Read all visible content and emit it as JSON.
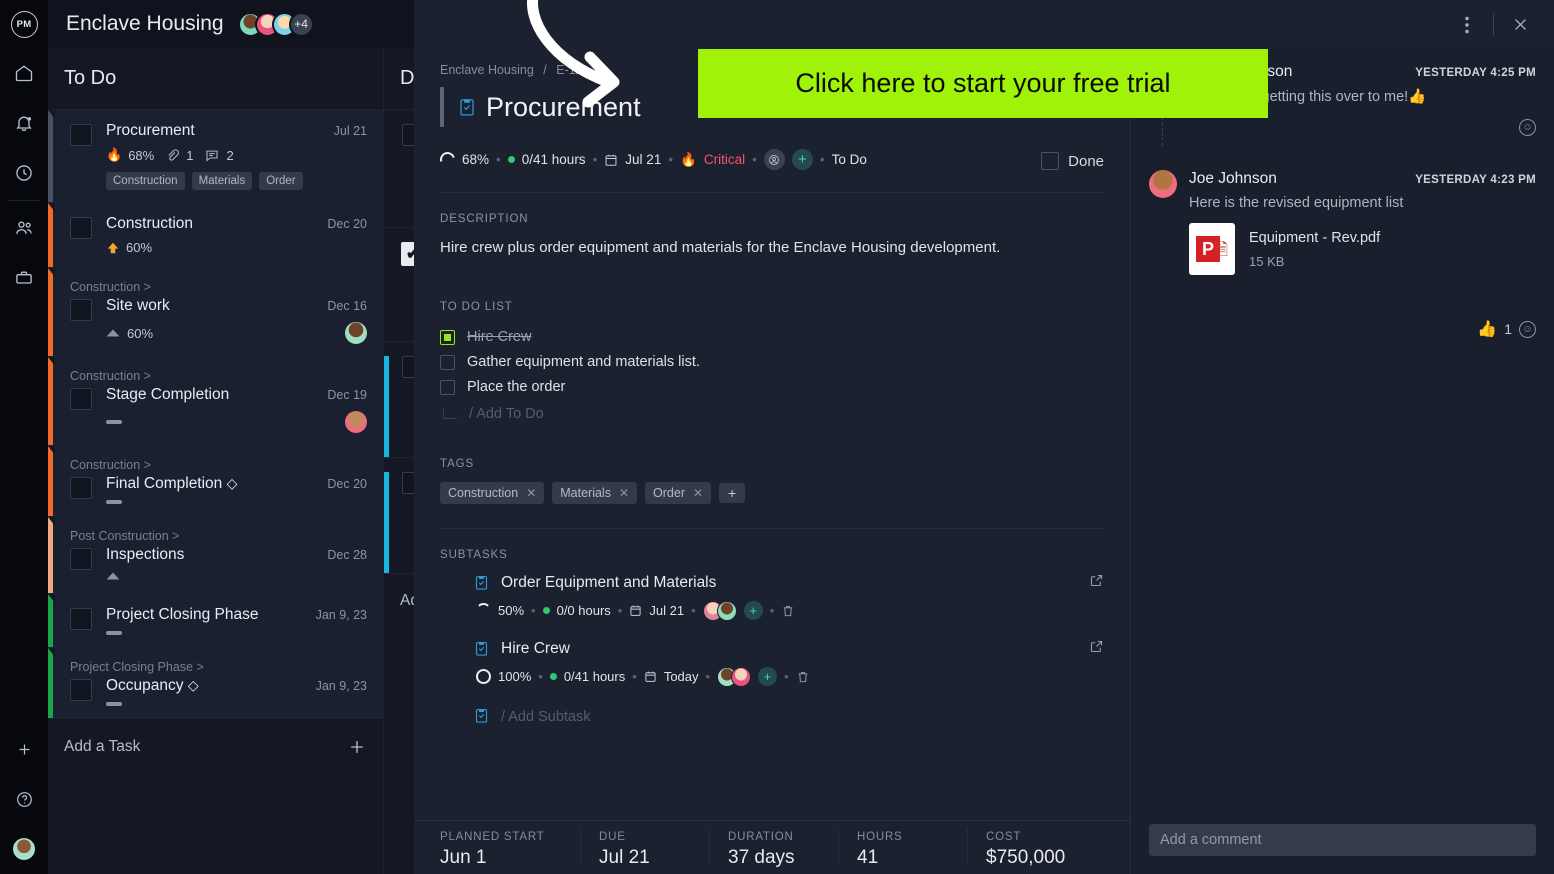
{
  "rail": {
    "logo": "PM",
    "items": [
      {
        "name": "home-icon",
        "label": "Home"
      },
      {
        "name": "notifications-icon",
        "label": "Notifications"
      },
      {
        "name": "time-icon",
        "label": "Time"
      },
      {
        "name": "people-icon",
        "label": "People"
      },
      {
        "name": "portfolio-icon",
        "label": "Portfolio"
      }
    ],
    "bottom": [
      {
        "name": "add-icon",
        "label": "+"
      },
      {
        "name": "help-icon",
        "label": "?"
      },
      {
        "name": "user-avatar",
        "label": ""
      }
    ]
  },
  "board": {
    "project_title": "Enclave Housing",
    "avatars_more": "+4",
    "columns": [
      {
        "title": "To Do",
        "add_label": "Add a Task",
        "add_icon": "plus-icon",
        "tasks": [
          {
            "name": "Procurement",
            "date": "Jul 21",
            "bar": "#4a5162",
            "priority_icon": "fire-icon",
            "progress": "68%",
            "attachments": "1",
            "comments": "2",
            "tags": [
              "Construction",
              "Materials",
              "Order"
            ]
          },
          {
            "name": "Construction",
            "date": "Dec 20",
            "bar": "#ef6b2b",
            "priority_icon": "up-arrow-icon",
            "progress": "60%",
            "tags": []
          },
          {
            "parent": "Construction >",
            "name": "Site work",
            "date": "Dec 16",
            "bar": "#ef6b2b",
            "priority_icon": "triangle-up-icon",
            "progress": "60%",
            "avatar": "green",
            "tags": []
          },
          {
            "parent": "Construction >",
            "name": "Stage Completion",
            "date": "Dec 19",
            "bar": "#ef6b2b",
            "priority_icon": "dash-icon",
            "progress": "",
            "avatar": "red",
            "tags": []
          },
          {
            "parent": "Construction >",
            "name": "Final Completion",
            "date": "Dec 20",
            "bar": "#ef6b2b",
            "milestone": "◇",
            "priority_icon": "dash-icon",
            "progress": "",
            "tags": []
          },
          {
            "parent": "Post Construction >",
            "name": "Inspections",
            "date": "Dec 28",
            "bar": "#f2a982",
            "priority_icon": "triangle-up-icon",
            "progress": "",
            "tags": []
          },
          {
            "name": "Project Closing Phase",
            "date": "Jan 9, 23",
            "bar": "#1aa44c",
            "priority_icon": "dash-icon",
            "progress": "",
            "tags": []
          },
          {
            "parent": "Project Closing Phase >",
            "name": "Occupancy",
            "date": "Jan 9, 23",
            "bar": "#1aa44c",
            "milestone": "◇",
            "priority_icon": "dash-icon",
            "progress": "",
            "tags": []
          }
        ]
      },
      {
        "title": "D",
        "add_label": "Ad"
      }
    ]
  },
  "modal": {
    "menu_icon": "kebab-menu-icon",
    "close_icon": "close-icon",
    "breadcrumb": {
      "project": "Enclave Housing",
      "separator": "/",
      "code": "E-11"
    },
    "task_icon": "task-clipboard-icon",
    "title": "Procurement",
    "done_label": "Done",
    "meta": {
      "progress": "68%",
      "hours": "0/41 hours",
      "calendar_icon": "calendar-icon",
      "due": "Jul 21",
      "priority_icon": "fire-icon",
      "priority": "Critical",
      "assignee_icon": "assignee-icon",
      "add_assignee_icon": "plus-icon",
      "status": "To Do"
    },
    "description_label": "DESCRIPTION",
    "description": "Hire crew plus order equipment and materials for the Enclave Housing development.",
    "todo_label": "TO DO LIST",
    "todos": [
      {
        "text": "Hire Crew",
        "done": true
      },
      {
        "text": "Gather equipment and materials list.",
        "done": false
      },
      {
        "text": "Place the order",
        "done": false
      }
    ],
    "add_todo": "/ Add To Do",
    "tags_label": "TAGS",
    "tags": [
      "Construction",
      "Materials",
      "Order"
    ],
    "tag_remove_icon": "close-icon",
    "tag_add_icon": "plus-icon",
    "subtasks_label": "SUBTASKS",
    "subtasks": [
      {
        "icon": "task-clipboard-icon",
        "name": "Order Equipment and Materials",
        "open_icon": "open-external-icon",
        "progress": "50%",
        "hours": "0/0 hours",
        "calendar_icon": "calendar-icon",
        "due": "Jul 21",
        "add_assignee_icon": "plus-icon",
        "delete_icon": "trash-icon"
      },
      {
        "icon": "task-clipboard-icon",
        "name": "Hire Crew",
        "open_icon": "open-external-icon",
        "progress": "100%",
        "hours": "0/41 hours",
        "calendar_icon": "calendar-icon",
        "due": "Today",
        "add_assignee_icon": "plus-icon",
        "delete_icon": "trash-icon"
      }
    ],
    "add_subtask": "/ Add Subtask",
    "footer": [
      {
        "label": "PLANNED START",
        "value": "Jun 1"
      },
      {
        "label": "DUE",
        "value": "Jul 21"
      },
      {
        "label": "DURATION",
        "value": "37 days"
      },
      {
        "label": "HOURS",
        "value": "41"
      },
      {
        "label": "COST",
        "value": "$750,000"
      }
    ]
  },
  "comments": {
    "items": [
      {
        "author": "Adam Jonnson",
        "time": "YESTERDAY 4:25 PM",
        "text": "Thanks for getting this over to me!👍",
        "react_icon": "add-reaction-icon"
      },
      {
        "author": "Joe Johnson",
        "time": "YESTERDAY 4:23 PM",
        "text": "Here is the revised equipment list",
        "attachment": {
          "name": "Equipment - Rev.pdf",
          "size": "15 KB",
          "icon": "pdf-file-icon"
        },
        "reaction": {
          "emoji": "👍",
          "count": "1"
        },
        "react_icon": "add-reaction-icon"
      }
    ],
    "input_placeholder": "Add a comment"
  },
  "overlay": {
    "cta_text": "Click here to start your free trial",
    "cta_color": "#a0f308",
    "arrow_icon": "curved-arrow-icon"
  }
}
